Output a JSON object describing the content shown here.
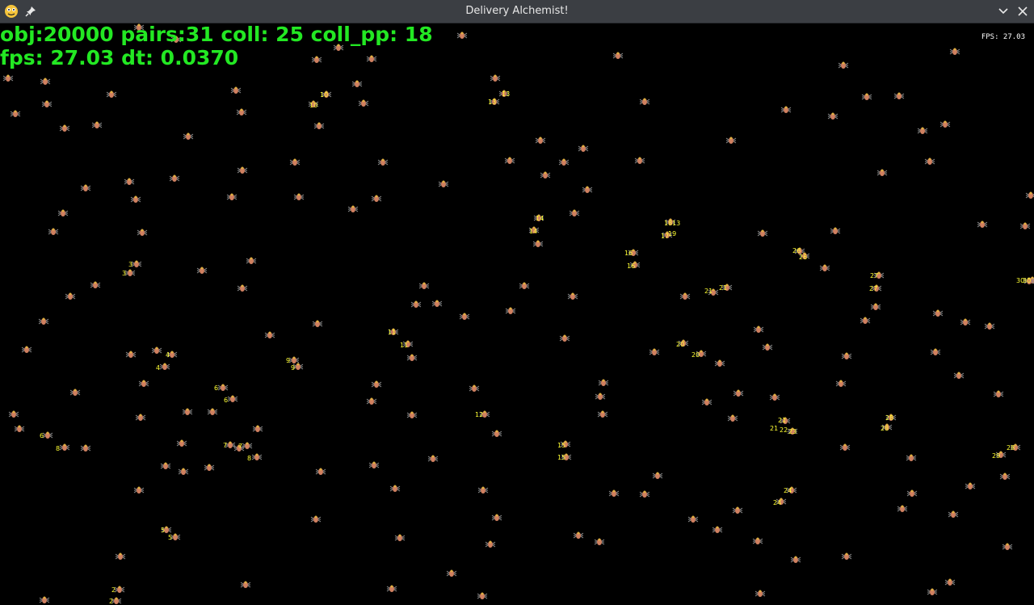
{
  "window": {
    "title": "Delivery Alchemist!",
    "icons": {
      "app": "python-icon",
      "pin": "pin-icon",
      "minimize": "chevron-down-icon",
      "close": "close-icon"
    }
  },
  "hud": {
    "line1": "obj:20000 pairs:31 coll: 25 coll_pp: 18",
    "line2": "fps: 27.03 dt: 0.0370",
    "fps_corner": "FPS: 27.03",
    "color": "#23e823"
  },
  "sprite_labels": [
    "1",
    "2",
    "3",
    "4",
    "5",
    "6",
    "7",
    "8",
    "9",
    "10",
    "11",
    "12",
    "13",
    "14",
    "15",
    "16",
    "17",
    "18",
    "19",
    "20",
    "21",
    "22",
    "23",
    "24",
    "25",
    "26",
    "27",
    "28",
    "29",
    "30"
  ],
  "colors": {
    "background": "#000000",
    "label": "#ffff33",
    "sprite_body": "#d08060",
    "sprite_legs": "#909090"
  }
}
